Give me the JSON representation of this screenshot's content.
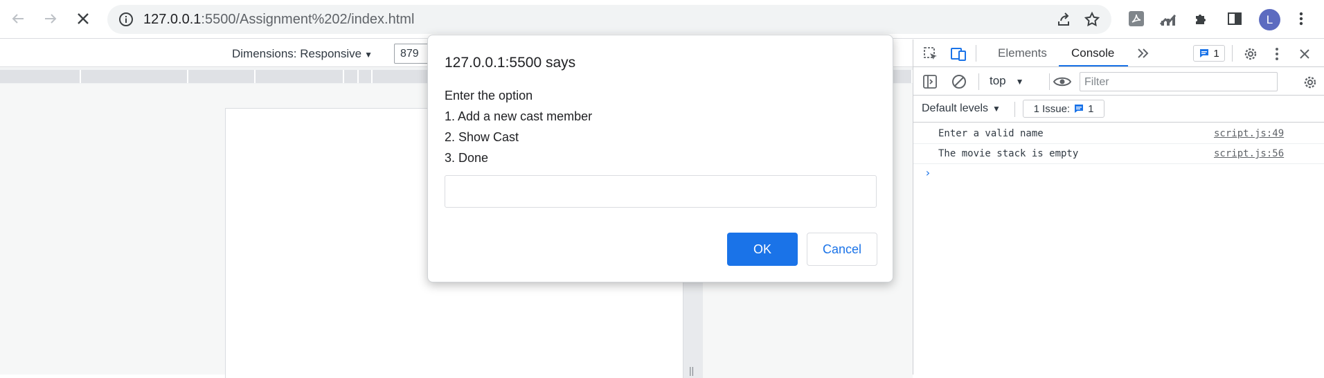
{
  "browser": {
    "url_host": "127.0.0.1",
    "url_rest": ":5500/Assignment%202/index.html",
    "avatar_letter": "L"
  },
  "device_toolbar": {
    "dimensions_label": "Dimensions: Responsive",
    "width_value": "879"
  },
  "devtools": {
    "tabs": [
      {
        "label": "Elements"
      },
      {
        "label": "Console"
      }
    ],
    "issues_badge_count": "1",
    "context": "top",
    "filter_placeholder": "Filter",
    "default_levels": "Default levels",
    "issue_chip_label": "1 Issue:",
    "issue_chip_count": "1",
    "logs": [
      {
        "message": "Enter a valid name",
        "source": "script.js:49"
      },
      {
        "message": "The movie stack is empty",
        "source": "script.js:56"
      }
    ]
  },
  "dialog": {
    "title": "127.0.0.1:5500 says",
    "lines": [
      "Enter the option",
      "1. Add a new cast member",
      "2. Show Cast",
      "3. Done"
    ],
    "input_value": "",
    "ok_label": "OK",
    "cancel_label": "Cancel"
  },
  "colors": {
    "accent": "#1a73e8",
    "avatar": "#5c6bc0"
  }
}
